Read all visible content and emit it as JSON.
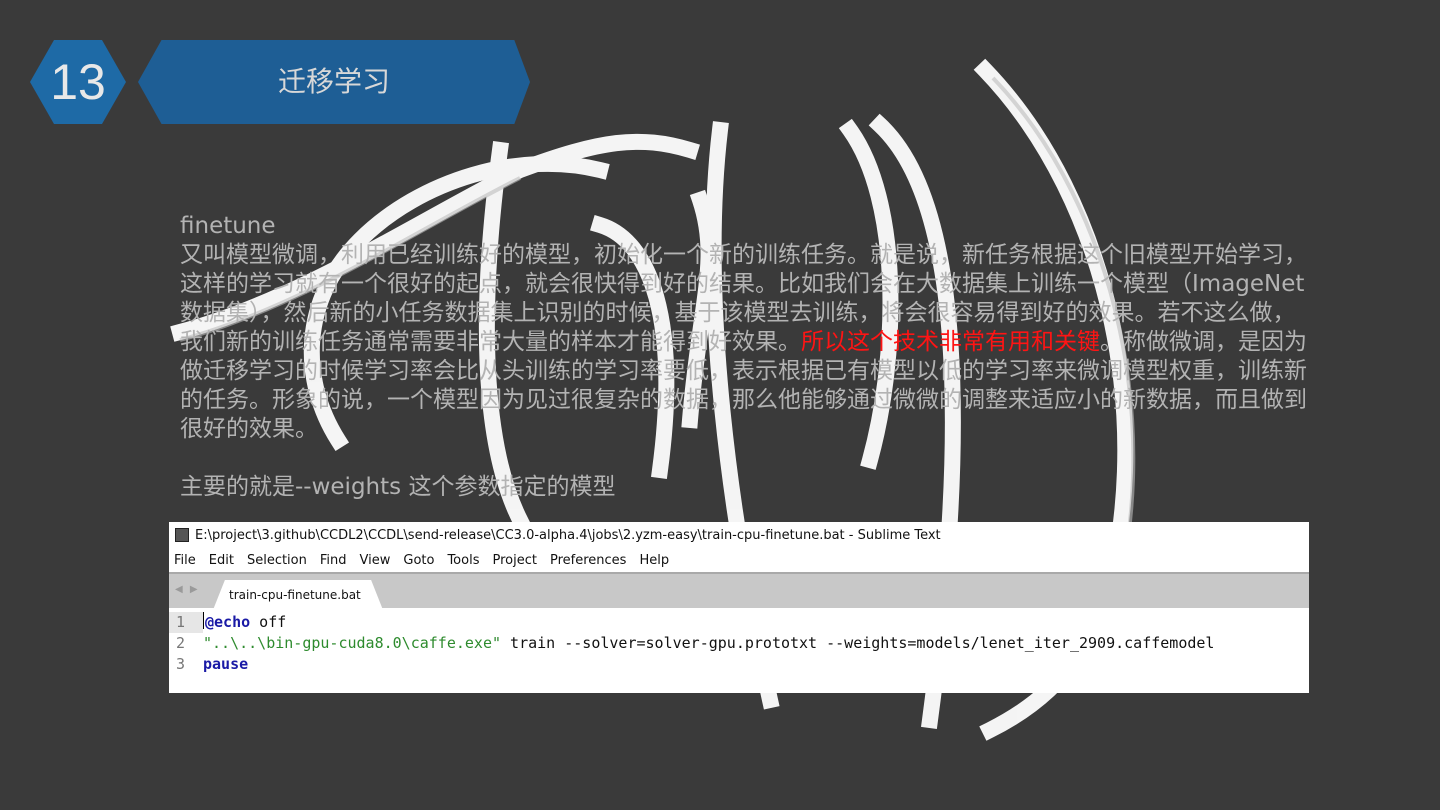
{
  "slide": {
    "number": "13",
    "title": "迁移学习"
  },
  "content": {
    "heading": "finetune",
    "paragraph_before_red": "又叫模型微调，利用已经训练好的模型，初始化一个新的训练任务。就是说，新任务根据这个旧模型开始学习，这样的学习就有一个很好的起点，就会很快得到好的结果。比如我们会在大数据集上训练一个模型（ImageNet 数据集），然后新的小任务数据集上识别的时候，基于该模型去训练，将会很容易得到好的效果。若不这么做，我们新的训练任务通常需要非常大量的样本才能得到好效果。",
    "paragraph_red": "所以这个技术非常有用和关键",
    "paragraph_after_red": "。称做微调，是因为做迁移学习的时候学习率会比从头训练的学习率要低，表示根据已有模型以低的学习率来微调模型权重，训练新的任务。形象的说，一个模型因为见过很复杂的数据，那么他能够通过微微的调整来适应小的新数据，而且做到很好的效果。",
    "note": "主要的就是--weights 这个参数指定的模型"
  },
  "editor": {
    "window_title": "E:\\project\\3.github\\CCDL2\\CCDL\\send-release\\CC3.0-alpha.4\\jobs\\2.yzm-easy\\train-cpu-finetune.bat - Sublime Text",
    "menu": [
      "File",
      "Edit",
      "Selection",
      "Find",
      "View",
      "Goto",
      "Tools",
      "Project",
      "Preferences",
      "Help"
    ],
    "nav_arrows": "◀ ▶",
    "tab_label": "train-cpu-finetune.bat",
    "tab_close": "×",
    "lines": [
      {
        "num": "1",
        "kw": "@echo",
        "rest": " off"
      },
      {
        "num": "2",
        "str": "\"..\\..\\bin-gpu-cuda8.0\\caffe.exe\"",
        "rest": " train --solver=solver-gpu.prototxt --weights=models/lenet_iter_2909.caffemodel"
      },
      {
        "num": "3",
        "kw": "pause"
      }
    ]
  },
  "colors": {
    "background": "#3a3a3a",
    "accent_blue": "#1e6aa6",
    "highlight_red": "#ff1414",
    "keyword": "#1a1aa6",
    "string": "#2e8b2e"
  }
}
